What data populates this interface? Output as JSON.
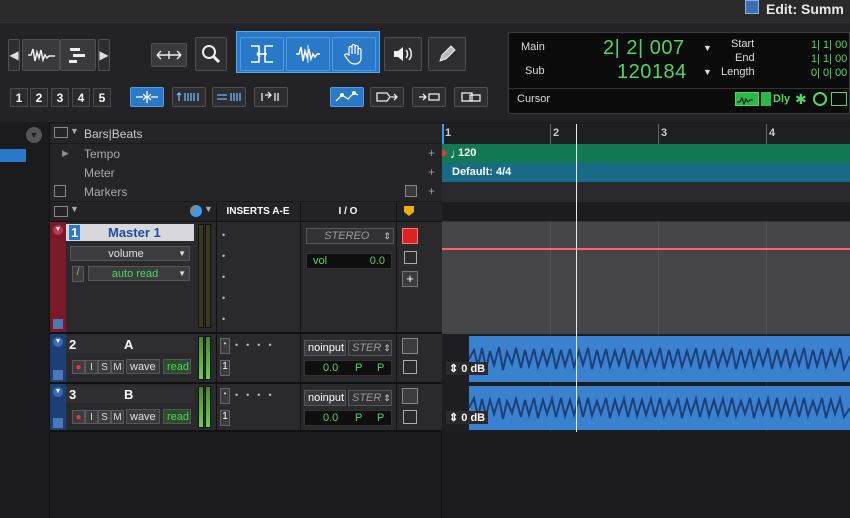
{
  "window": {
    "title": "Edit: Summ"
  },
  "toolbar": {
    "grid_numbers": [
      "1",
      "2",
      "3",
      "4",
      "5"
    ],
    "icons": [
      "zoom-icon",
      "trim-icon",
      "select-icon",
      "grab-icon",
      "scrub-icon",
      "pencil-icon"
    ]
  },
  "counter": {
    "main_label": "Main",
    "main_value": "2| 2| 007",
    "sub_label": "Sub",
    "sub_value": "120184",
    "start_label": "Start",
    "end_label": "End",
    "length_label": "Length",
    "start_value": "1| 1| 00",
    "end_value": "1| 1| 00",
    "length_value": "0| 0| 00",
    "cursor_label": "Cursor",
    "dly_label": "Dly"
  },
  "rulers": {
    "bars_beats": "Bars|Beats",
    "tempo": "Tempo",
    "meter": "Meter",
    "markers": "Markers",
    "bar_numbers": [
      "1",
      "2",
      "3",
      "4"
    ],
    "tempo_value": "120",
    "meter_value": "Default: 4/4"
  },
  "columns": {
    "inserts": "INSERTS A-E",
    "io": "I / O"
  },
  "tracks": [
    {
      "number": "1",
      "name": "Master 1",
      "view": "volume",
      "automation": "auto read",
      "output": "STEREO",
      "vol_label": "vol",
      "vol_value": "0.0"
    },
    {
      "number": "2",
      "name": "A",
      "view": "wave",
      "automation": "read",
      "input": "noinput",
      "output": "STER",
      "vol_value": "0.0",
      "pan_l": "P",
      "pan_r": "P",
      "insert_num": "1",
      "clip_gain": "0 dB"
    },
    {
      "number": "3",
      "name": "B",
      "view": "wave",
      "automation": "read",
      "input": "noinput",
      "output": "STER",
      "vol_value": "0.0",
      "pan_l": "P",
      "pan_r": "P",
      "insert_num": "1",
      "clip_gain": "0 dB"
    }
  ],
  "track_buttons": {
    "rec": "●",
    "input": "I",
    "solo": "S",
    "mute": "M"
  }
}
